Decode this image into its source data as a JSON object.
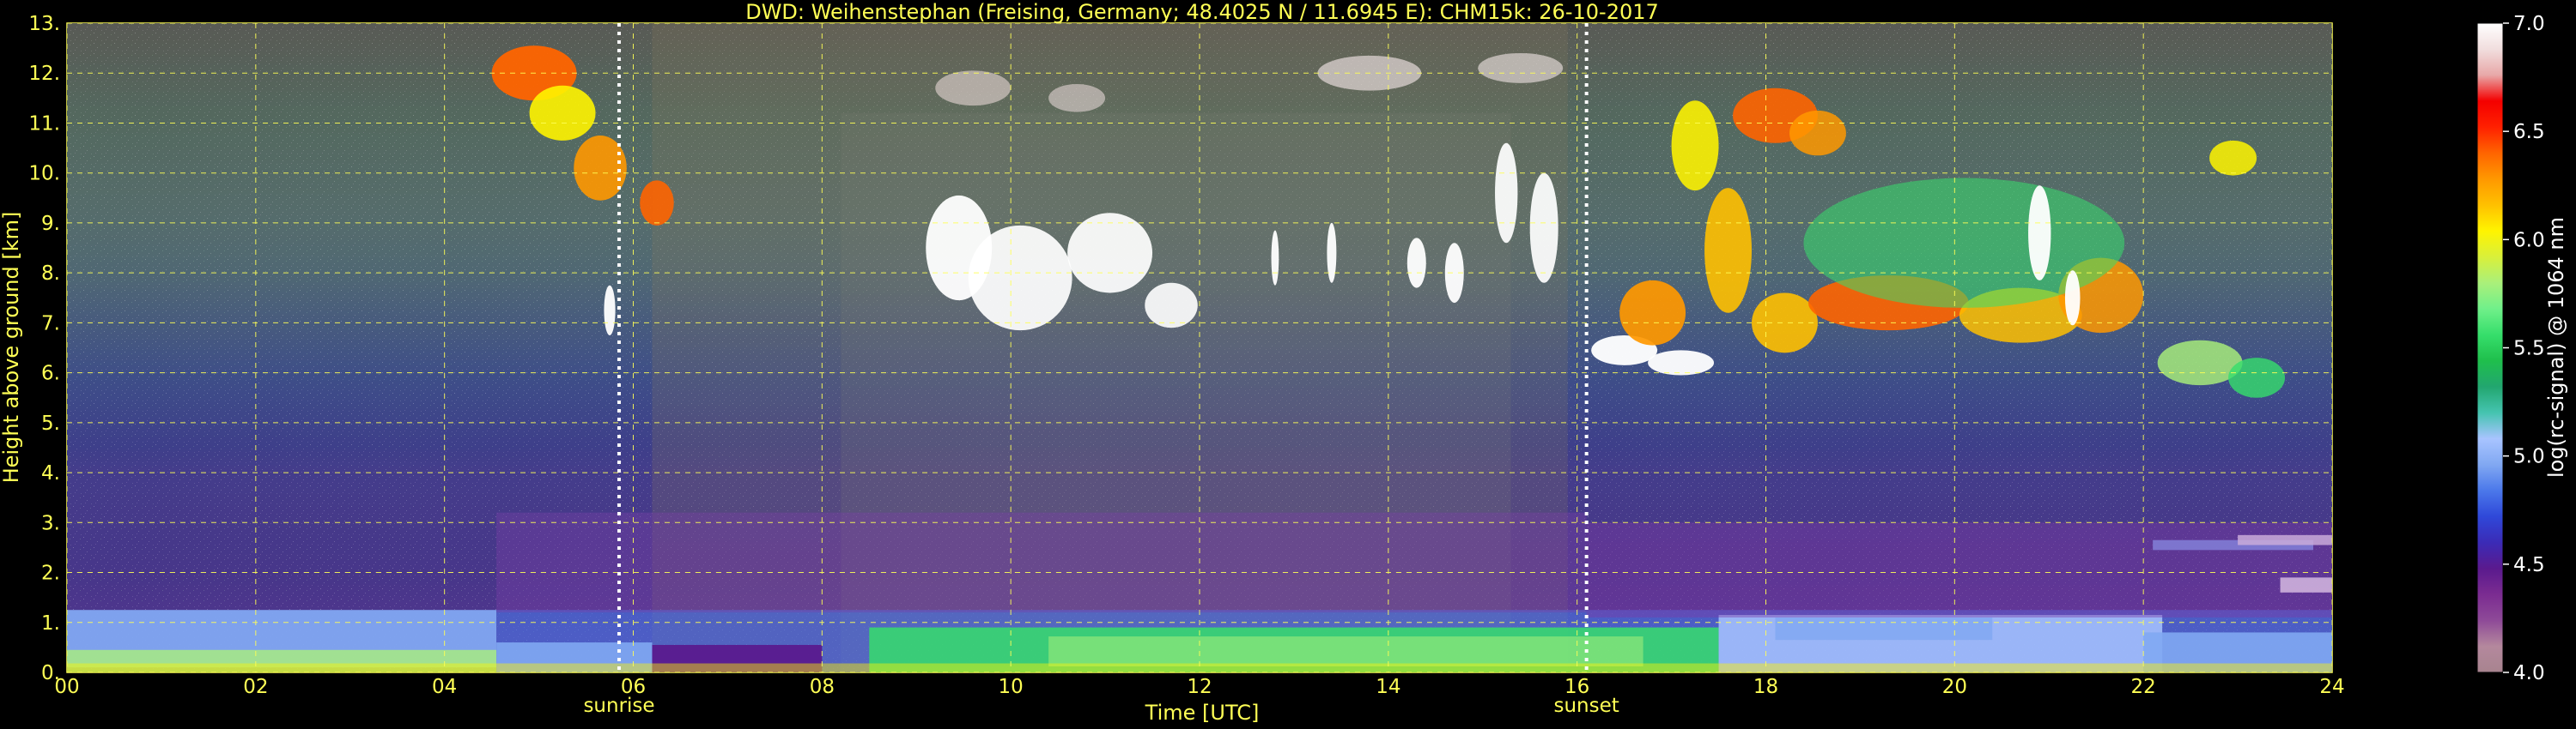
{
  "chart_data": {
    "type": "heatmap",
    "title": "DWD: Weihenstephan (Freising, Germany; 48.4025 N / 11.6945 E):    CHM15k: 26-10-2017",
    "xlabel": "Time [UTC]",
    "ylabel": "Height above ground [km]",
    "xlim": [
      0,
      24
    ],
    "ylim": [
      0,
      13
    ],
    "x_ticks": [
      "00",
      "02",
      "04",
      "06",
      "08",
      "10",
      "12",
      "14",
      "16",
      "18",
      "20",
      "22",
      "24"
    ],
    "y_ticks": [
      "0.",
      "1.",
      "2.",
      "3.",
      "4.",
      "5.",
      "6.",
      "7.",
      "8.",
      "9.",
      "10.",
      "11.",
      "12.",
      "13."
    ],
    "grid": true,
    "colorbar": {
      "label": "log(rc-signal) @ 1064 nm",
      "range": [
        4.0,
        7.0
      ],
      "ticks": [
        "4.0",
        "4.5",
        "5.0",
        "5.5",
        "6.0",
        "6.5",
        "7.0"
      ],
      "colors": [
        "#a8848f",
        "#b4889d",
        "#8e4a98",
        "#7b2c91",
        "#5a1a8e",
        "#3b2bb6",
        "#2f48d9",
        "#4b78ea",
        "#81a8f2",
        "#a8c4ff",
        "#45c4b0",
        "#22a66f",
        "#1fbf4c",
        "#36de6b",
        "#70f08a",
        "#aaf07a",
        "#d9f03a",
        "#fff400",
        "#ffc000",
        "#ff9800",
        "#ff6400",
        "#ff2000",
        "#f40000",
        "#e8a8a8",
        "#f1dede",
        "#ffffff"
      ]
    },
    "markers": [
      {
        "x": 5.85,
        "label": "sunrise"
      },
      {
        "x": 16.1,
        "label": "sunset"
      }
    ],
    "features": [
      {
        "name": "boundary layer",
        "x_start": 0,
        "x_end": 24,
        "y_range": [
          0,
          1.3
        ],
        "value_range": [
          4.6,
          6.8
        ]
      },
      {
        "name": "cirrus morning",
        "x_start": 4.5,
        "x_end": 6.0,
        "y_range": [
          8.9,
          12.5
        ],
        "value_range": [
          6.0,
          6.6
        ]
      },
      {
        "name": "cirrus midday",
        "x_start": 9.0,
        "x_end": 11.8,
        "y_range": [
          6.7,
          9.7
        ],
        "value_range": [
          6.5,
          7.0
        ]
      },
      {
        "name": "cirrus afternoon",
        "x_start": 16.0,
        "x_end": 23.7,
        "y_range": [
          5.4,
          11.9
        ],
        "value_range": [
          5.3,
          6.9
        ]
      }
    ]
  }
}
